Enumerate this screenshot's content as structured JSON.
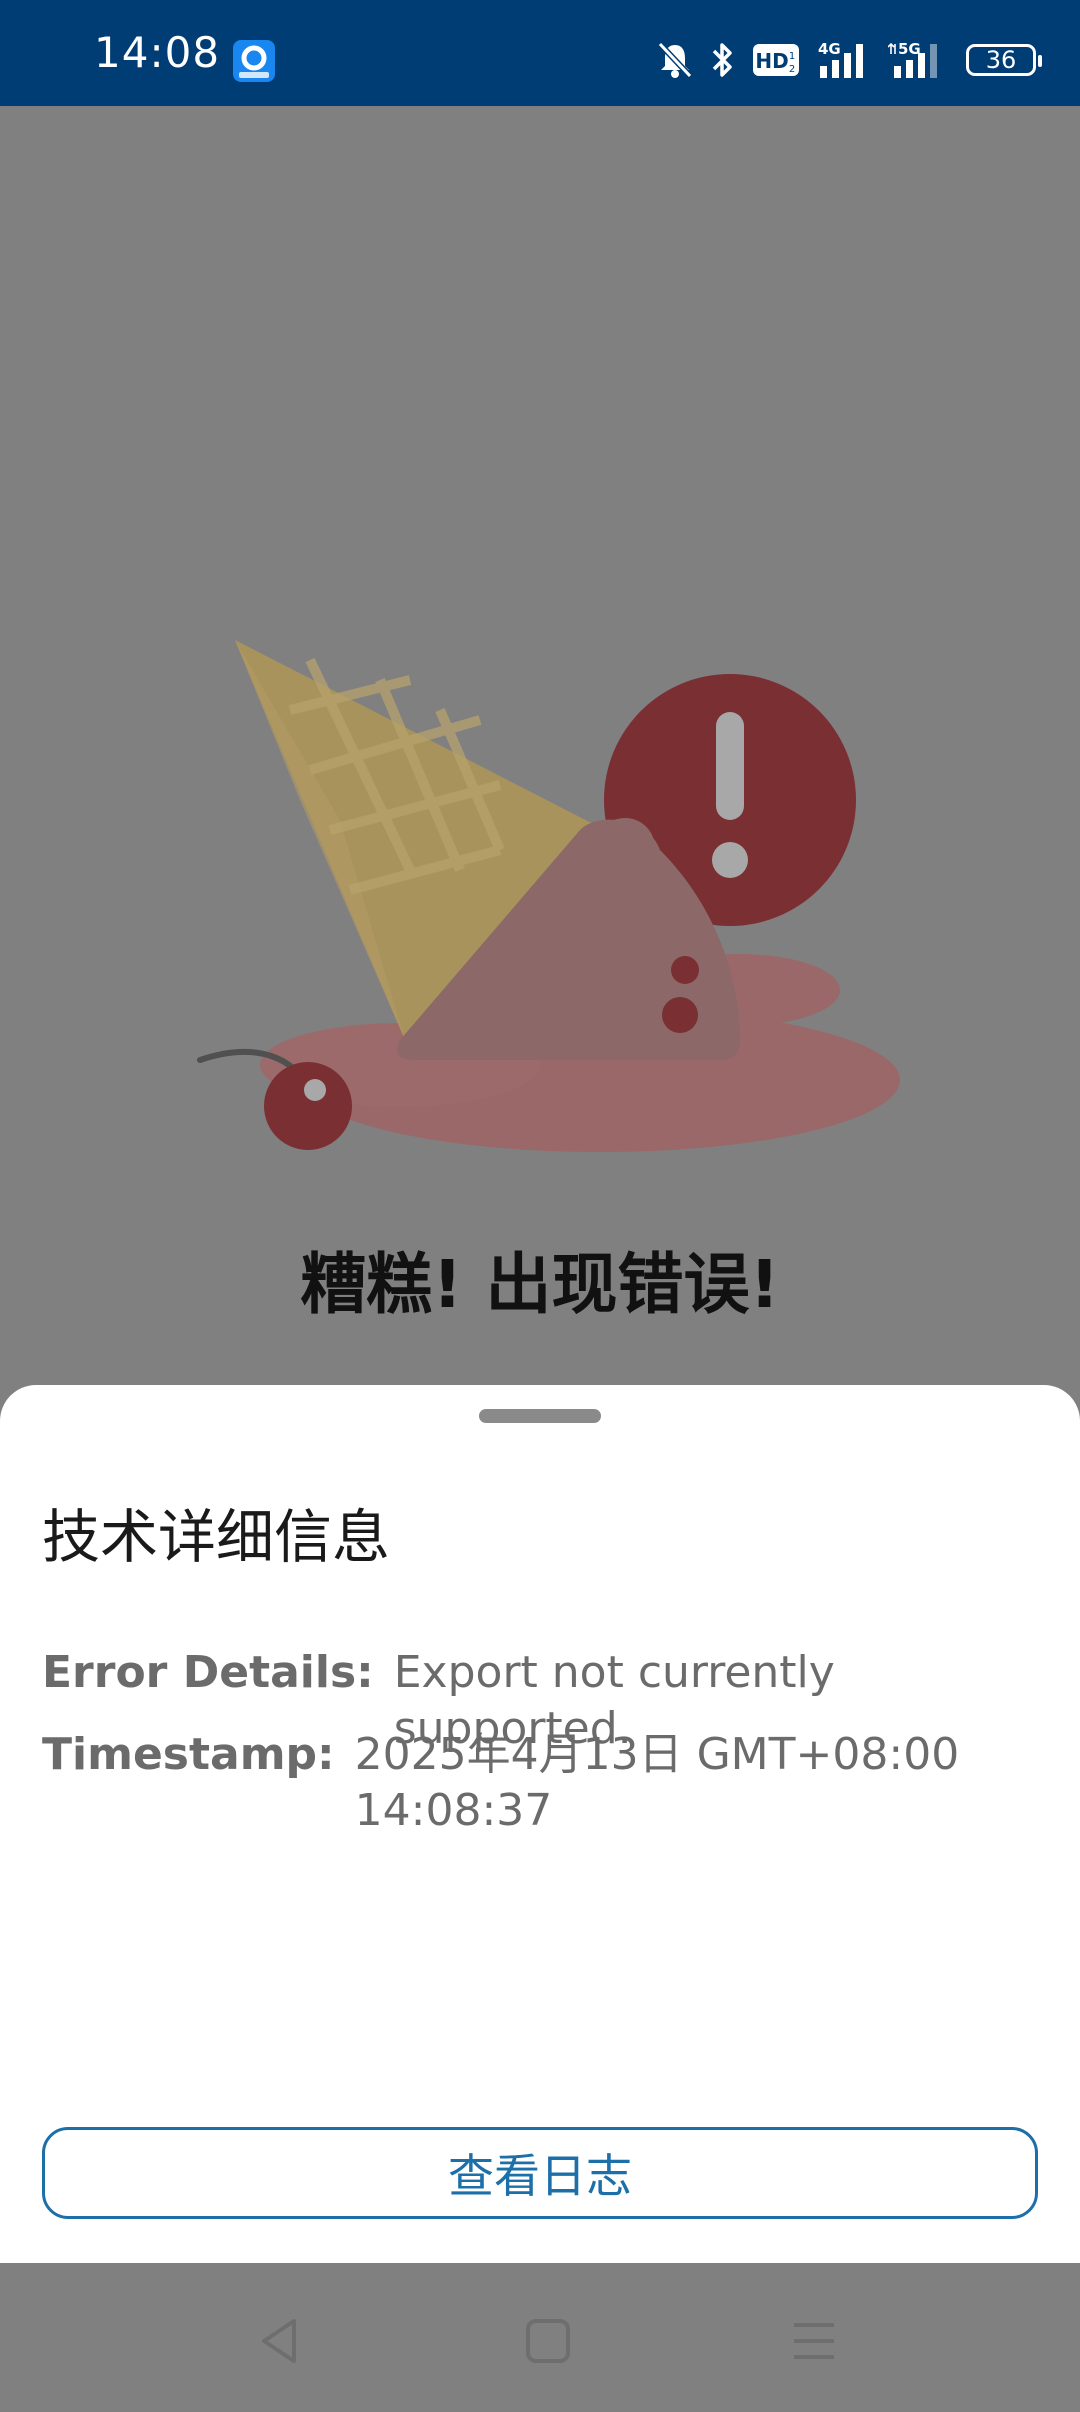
{
  "status_bar": {
    "time": "14:08",
    "icons": [
      "app-notification-icon",
      "mute-icon",
      "bluetooth-icon",
      "hd-icon",
      "signal-4g-icon",
      "signal-5g-icon"
    ],
    "hd_label": "HD",
    "net_4g": "4G",
    "net_5g": "5G",
    "battery": "36"
  },
  "error_screen": {
    "title": "糟糕! 出现错误!"
  },
  "sheet": {
    "title": "技术详细信息",
    "error_label": "Error Details:",
    "error_value": "Export not currently supported.",
    "timestamp_label": "Timestamp:",
    "timestamp_value": "2025年4月13日 GMT+08:00 14:08:37",
    "view_log_button": "查看日志"
  },
  "colors": {
    "status_bar": "#003d74",
    "scrim": "#808080",
    "accent": "#1c6fa8",
    "alert_red": "#7a2f33"
  }
}
